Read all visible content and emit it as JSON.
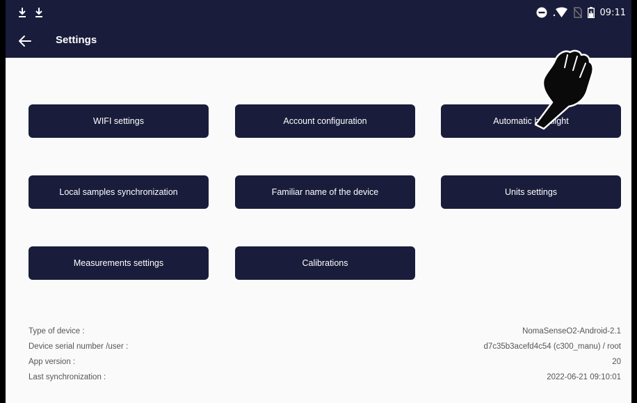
{
  "status_bar": {
    "time": "09:11",
    "icons": [
      "download-icon",
      "download-icon",
      "do-not-disturb-icon",
      "wifi-icon",
      "no-sim-icon",
      "battery-charging-icon"
    ]
  },
  "header": {
    "back_icon": "arrow-left-icon",
    "title": "Settings"
  },
  "buttons": {
    "wifi": "WIFI settings",
    "account": "Account configuration",
    "backlight": "Automatic backlight",
    "sync": "Local samples synchronization",
    "familiar_name": "Familiar name of the device",
    "units": "Units settings",
    "measurements": "Measurements settings",
    "calibrations": "Calibrations"
  },
  "device_info": {
    "type_label": "Type of device :",
    "type_value": "NomaSenseO2-Android-2.1",
    "serial_label": "Device serial number /user :",
    "serial_value": "d7c35b3acefd4c54 (c300_manu) / root",
    "app_version_label": "App version :",
    "app_version_value": "20",
    "last_sync_label": "Last synchronization :",
    "last_sync_value": "2022-06-21 09:10:01"
  },
  "colors": {
    "primary": "#191c3a",
    "background": "#fafafa",
    "text_muted": "#555555"
  }
}
